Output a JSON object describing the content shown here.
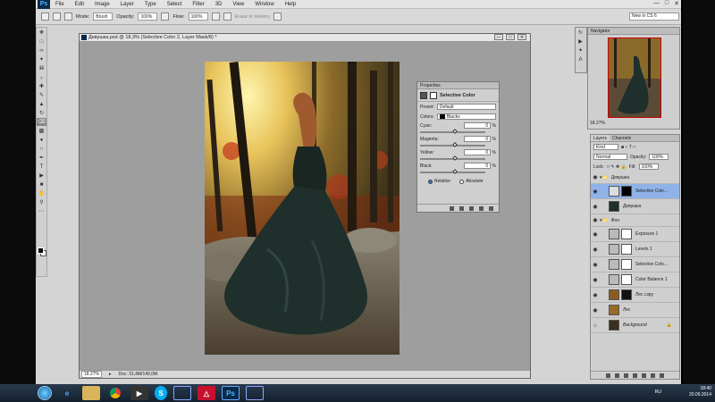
{
  "menubar": {
    "logo": "Ps",
    "items": [
      "File",
      "Edit",
      "Image",
      "Layer",
      "Type",
      "Select",
      "Filter",
      "3D",
      "View",
      "Window",
      "Help"
    ]
  },
  "options": {
    "mode_label": "Mode:",
    "mode_value": "Brush",
    "opacity_label": "Opacity:",
    "opacity_value": "100%",
    "flow_label": "Flow:",
    "flow_value": "100%",
    "erase_history": "Erase to History",
    "workspace": "New in CS 6"
  },
  "document": {
    "title": "Девушка.psd @ 18,3% (Selective Color 2, Layer Mask/8) *",
    "zoom": "18.27%",
    "doc_info": "Doc: 31,4M/149,0M"
  },
  "properties": {
    "tab": "Properties",
    "heading": "Selective Color",
    "preset_label": "Preset:",
    "preset_value": "Default",
    "colors_label": "Colors:",
    "colors_value": "Blacks",
    "sliders": [
      {
        "label": "Cyan:",
        "value": "0",
        "unit": "%"
      },
      {
        "label": "Magenta:",
        "value": "0",
        "unit": "%"
      },
      {
        "label": "Yellow:",
        "value": "0",
        "unit": "%"
      },
      {
        "label": "Black:",
        "value": "0",
        "unit": "%"
      }
    ],
    "relative": "Relative",
    "absolute": "Absolute"
  },
  "navigator": {
    "tab": "Navigator",
    "zoom": "18.27%"
  },
  "layers": {
    "tabs": [
      "Layers",
      "Channels"
    ],
    "kind": "Kind",
    "blend": "Normal",
    "opacity_label": "Opacity:",
    "opacity_value": "100%",
    "lock_label": "Lock:",
    "fill_label": "Fill:",
    "fill_value": "100%",
    "rows": [
      {
        "name": "Девушка",
        "type": "group"
      },
      {
        "name": "Selective Colo...",
        "type": "adjustment",
        "selected": true
      },
      {
        "name": "Девушка",
        "type": "pixel"
      },
      {
        "name": "Фон",
        "type": "group"
      },
      {
        "name": "Exposure 1",
        "type": "adjustment"
      },
      {
        "name": "Levels 1",
        "type": "adjustment"
      },
      {
        "name": "Selective Colo...",
        "type": "adjustment"
      },
      {
        "name": "Color Balance 1",
        "type": "adjustment"
      },
      {
        "name": "Лес сзру",
        "type": "pixel"
      },
      {
        "name": "Лес",
        "type": "pixel"
      },
      {
        "name": "Background",
        "type": "background"
      }
    ]
  },
  "taskbar": {
    "lang": "RU",
    "time": "18:40",
    "date": "20.09.2014"
  },
  "colors": {
    "selected_layer": "#8fb3e8",
    "ps_blue": "#4ab3ff"
  }
}
